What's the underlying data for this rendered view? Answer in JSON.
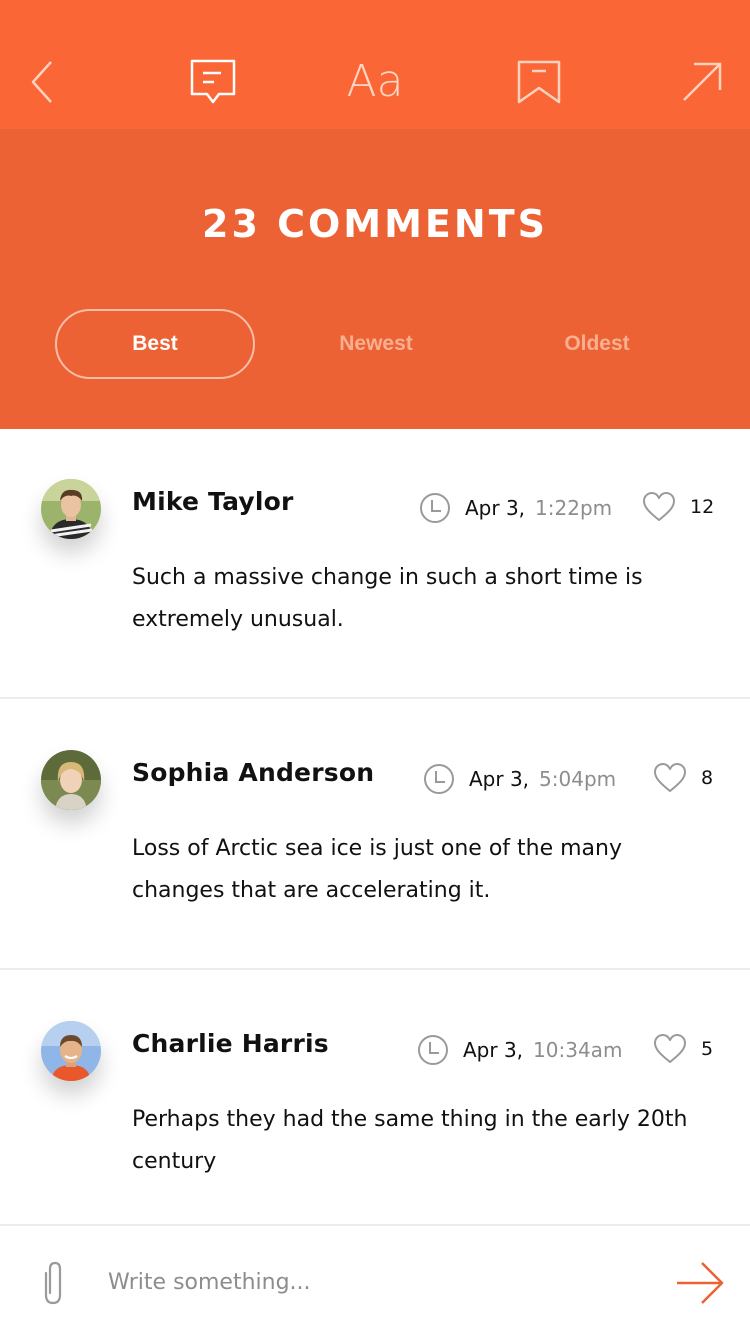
{
  "toolbar": {
    "font_label": "Aa",
    "icons": [
      "back-chevron-icon",
      "comments-icon",
      "font-size-icon",
      "bookmark-icon",
      "share-arrow-icon"
    ]
  },
  "header": {
    "title": "23 COMMENTS",
    "tabs": [
      {
        "label": "Best",
        "active": true
      },
      {
        "label": "Newest",
        "active": false
      },
      {
        "label": "Oldest",
        "active": false
      }
    ]
  },
  "comments": [
    {
      "author": "Mike Taylor",
      "date": "Apr 3,",
      "time": "1:22pm",
      "likes": "12",
      "text": "Such a massive change in such a short time is extremely unusual."
    },
    {
      "author": "Sophia Anderson",
      "date": "Apr 3,",
      "time": "5:04pm",
      "likes": "8",
      "text": "Loss of Arctic sea ice is just one of the many changes that are accelerating it."
    },
    {
      "author": "Charlie Harris",
      "date": "Apr 3,",
      "time": "10:34am",
      "likes": "5",
      "text": "Perhaps they had the same thing in the early 20th century"
    }
  ],
  "composer": {
    "placeholder": "Write something..."
  },
  "colors": {
    "topbar": "#fb6636",
    "header": "#ec6234",
    "accent": "#ec6234",
    "muted_text": "#8d8d8d"
  }
}
